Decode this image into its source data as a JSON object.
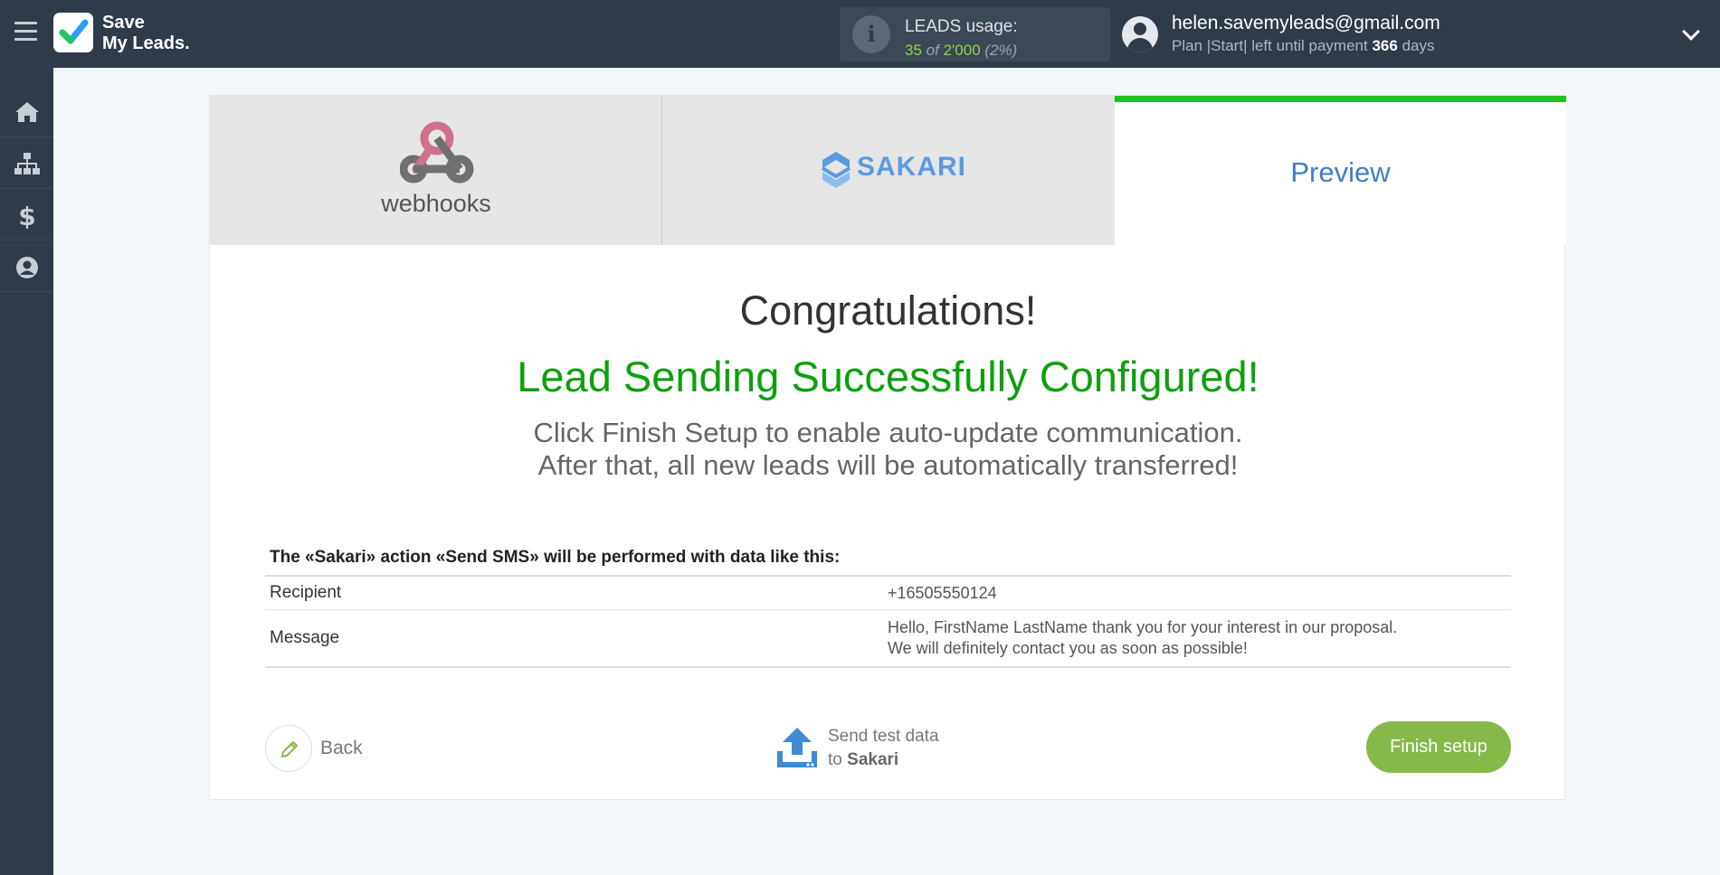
{
  "header": {
    "logo_line1": "Save",
    "logo_line2": "My Leads.",
    "usage_label": "LEADS usage:",
    "usage_used": "35",
    "usage_of": "of",
    "usage_total": "2'000",
    "usage_pct": "(2%)",
    "user_email": "helen.savemyleads@gmail.com",
    "plan_text": "Plan |Start| left until payment",
    "plan_days": "366",
    "plan_days_suffix": "days"
  },
  "sidebar": {
    "items": [
      {
        "name": "home",
        "icon": "home-icon"
      },
      {
        "name": "connections",
        "icon": "sitemap-icon"
      },
      {
        "name": "billing",
        "icon": "dollar-icon"
      },
      {
        "name": "account",
        "icon": "user-circle-icon"
      }
    ]
  },
  "tabs": {
    "source_label": "webhooks",
    "destination_label": "SAKARI",
    "preview_label": "Preview"
  },
  "main": {
    "congrats": "Congratulations!",
    "success": "Lead Sending Successfully Configured!",
    "instr_line1": "Click Finish Setup to enable auto-update communication.",
    "instr_line2": "After that, all new leads will be automatically transferred!",
    "table_caption": "The «Sakari» action «Send SMS» will be performed with data like this:",
    "rows": [
      {
        "key": "Recipient",
        "value": "+16505550124"
      },
      {
        "key": "Message",
        "value_line1": "Hello, FirstName LastName thank you for your interest in our proposal.",
        "value_line2": "We will definitely contact you as soon as possible!"
      }
    ]
  },
  "actions": {
    "back_label": "Back",
    "send_line1": "Send test data",
    "send_to": "to",
    "send_target": "Sakari",
    "finish_label": "Finish setup"
  },
  "colors": {
    "topbar": "#2f3b48",
    "success_green": "#0da00d",
    "finish_button": "#86b84a",
    "preview_tab_accent": "#1ec21e",
    "preview_text": "#3f7fc4"
  }
}
